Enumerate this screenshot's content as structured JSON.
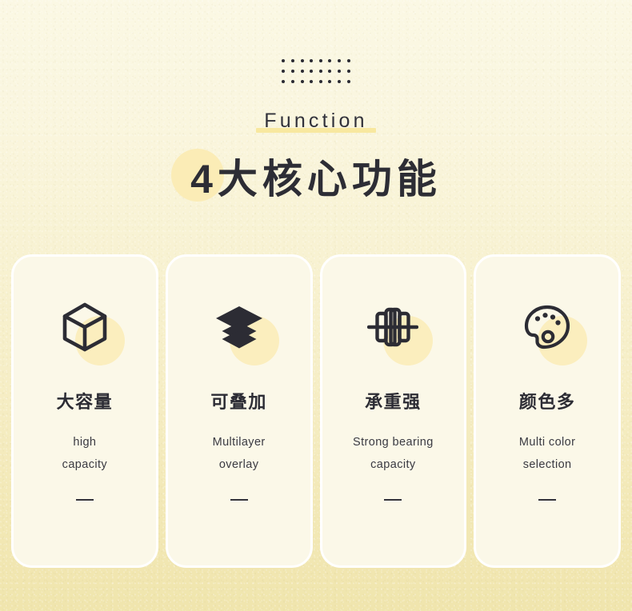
{
  "ornament": {
    "dot_grid_icon": "dot-grid-icon",
    "dot_columns": 8,
    "dot_rows": 3,
    "dot_color": "#2b2b33"
  },
  "header": {
    "eyebrow": "Function",
    "eyebrow_highlight_color": "#f8e89f",
    "title": "4大核心功能",
    "title_blob_color": "#fbecb6"
  },
  "theme": {
    "background_top": "#fbf8e4",
    "background_bottom": "#f0e5ad",
    "card_background": "#fbf8e8",
    "card_border": "#ffffff",
    "accent": "#fbeebe",
    "text_dark": "#2c2c34"
  },
  "cards": [
    {
      "icon": "cube-icon",
      "cn_title": "大容量",
      "en_line1": "high",
      "en_line2": "capacity"
    },
    {
      "icon": "layers-stack-icon",
      "cn_title": "可叠加",
      "en_line1": "Multilayer",
      "en_line2": "overlay"
    },
    {
      "icon": "dumbbell-icon",
      "cn_title": "承重强",
      "en_line1": "Strong bearing",
      "en_line2": "capacity"
    },
    {
      "icon": "palette-icon",
      "cn_title": "颜色多",
      "en_line1": "Multi color",
      "en_line2": "selection"
    }
  ]
}
